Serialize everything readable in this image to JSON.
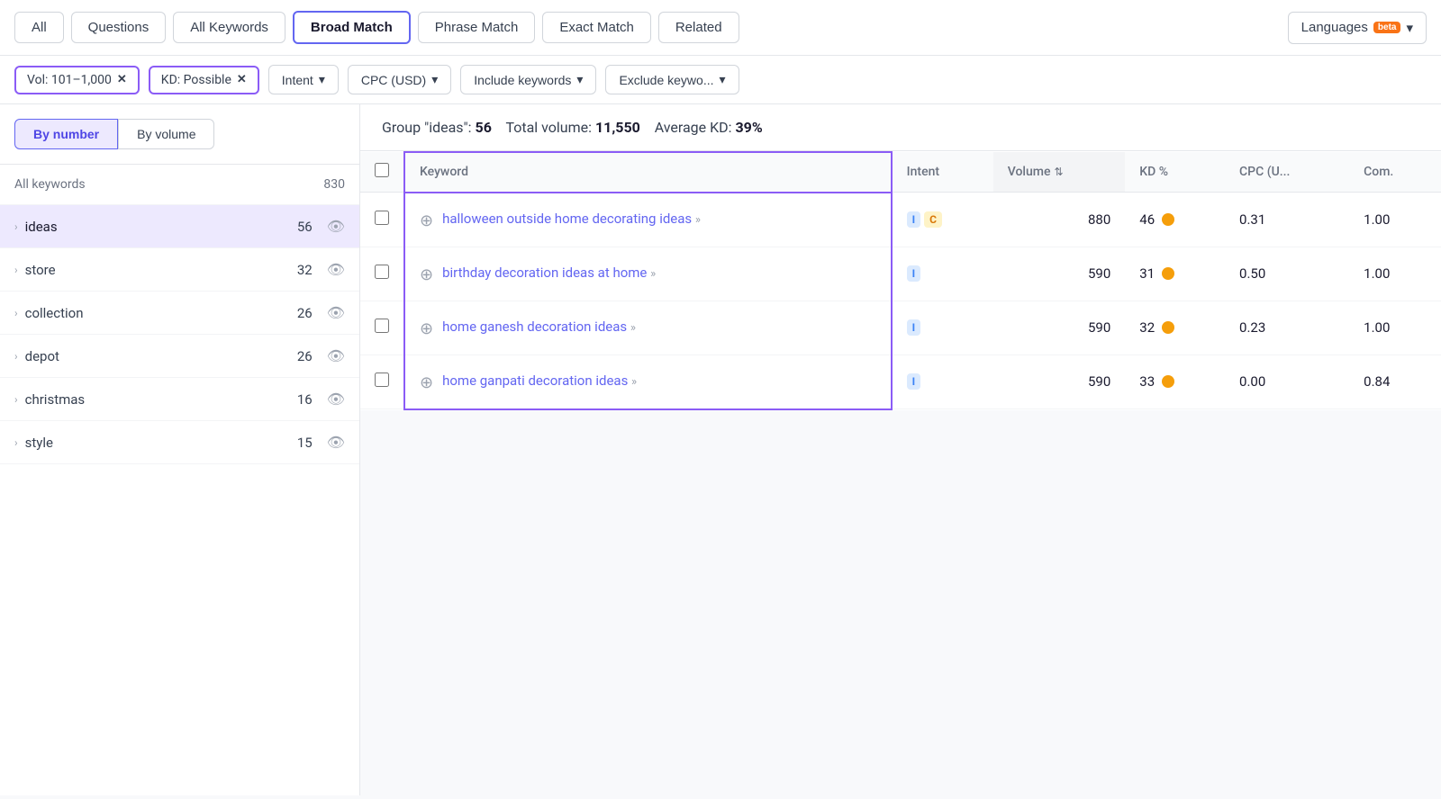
{
  "tabs": [
    {
      "id": "all",
      "label": "All",
      "active": false
    },
    {
      "id": "questions",
      "label": "Questions",
      "active": false
    },
    {
      "id": "all-keywords",
      "label": "All Keywords",
      "active": false
    },
    {
      "id": "broad-match",
      "label": "Broad Match",
      "active": true
    },
    {
      "id": "phrase-match",
      "label": "Phrase Match",
      "active": false
    },
    {
      "id": "exact-match",
      "label": "Exact Match",
      "active": false
    },
    {
      "id": "related",
      "label": "Related",
      "active": false
    }
  ],
  "languages_label": "Languages",
  "beta_label": "beta",
  "filters": [
    {
      "id": "vol-filter",
      "label": "Vol: 101–1,000"
    },
    {
      "id": "kd-filter",
      "label": "KD: Possible"
    }
  ],
  "dropdowns": [
    {
      "id": "intent",
      "label": "Intent"
    },
    {
      "id": "cpc",
      "label": "CPC (USD)"
    },
    {
      "id": "include-keywords",
      "label": "Include keywords"
    },
    {
      "id": "exclude-keywords",
      "label": "Exclude keywo..."
    }
  ],
  "sidebar": {
    "sort_by_number": "By number",
    "sort_by_volume": "By volume",
    "header_label": "All keywords",
    "header_count": "830",
    "items": [
      {
        "label": "ideas",
        "count": "56",
        "selected": true
      },
      {
        "label": "store",
        "count": "32",
        "selected": false
      },
      {
        "label": "collection",
        "count": "26",
        "selected": false
      },
      {
        "label": "depot",
        "count": "26",
        "selected": false
      },
      {
        "label": "christmas",
        "count": "16",
        "selected": false
      },
      {
        "label": "style",
        "count": "15",
        "selected": false
      }
    ]
  },
  "group_stats": {
    "prefix": "Group \"ideas\":",
    "count": "56",
    "volume_prefix": "Total volume:",
    "volume": "11,550",
    "kd_prefix": "Average KD:",
    "kd": "39%"
  },
  "table": {
    "columns": [
      {
        "id": "keyword",
        "label": "Keyword"
      },
      {
        "id": "intent",
        "label": "Intent"
      },
      {
        "id": "volume",
        "label": "Volume",
        "sorted": true
      },
      {
        "id": "kd",
        "label": "KD %"
      },
      {
        "id": "cpc",
        "label": "CPC (U..."
      },
      {
        "id": "com",
        "label": "Com."
      }
    ],
    "rows": [
      {
        "keyword": "halloween outside home decorating ideas",
        "intents": [
          "I",
          "C"
        ],
        "volume": "880",
        "kd": "46",
        "cpc": "0.31",
        "com": "1.00"
      },
      {
        "keyword": "birthday decoration ideas at home",
        "intents": [
          "I"
        ],
        "volume": "590",
        "kd": "31",
        "cpc": "0.50",
        "com": "1.00"
      },
      {
        "keyword": "home ganesh decoration ideas",
        "intents": [
          "I"
        ],
        "volume": "590",
        "kd": "32",
        "cpc": "0.23",
        "com": "1.00"
      },
      {
        "keyword": "home ganpati decoration ideas",
        "intents": [
          "I"
        ],
        "volume": "590",
        "kd": "33",
        "cpc": "0.00",
        "com": "0.84"
      }
    ]
  }
}
